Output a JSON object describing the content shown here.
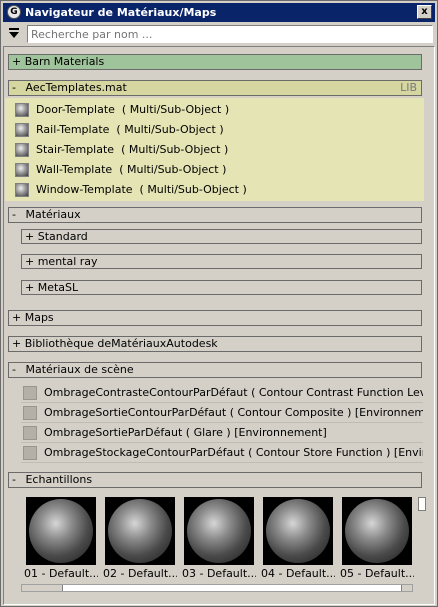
{
  "window": {
    "title": "Navigateur de Matériaux/Maps",
    "close_label": "x",
    "icon_label": "G"
  },
  "search": {
    "placeholder": "Recherche par nom ...",
    "value": ""
  },
  "groups": {
    "barn": {
      "toggle": "+",
      "label": "Barn Materials"
    },
    "aec": {
      "toggle": "-",
      "label": "AecTemplates.mat",
      "tag": "LIB",
      "items": [
        {
          "name": "Door-Template",
          "type": "( Multi/Sub-Object )"
        },
        {
          "name": "Rail-Template",
          "type": "( Multi/Sub-Object )"
        },
        {
          "name": "Stair-Template",
          "type": "( Multi/Sub-Object )"
        },
        {
          "name": "Wall-Template",
          "type": "( Multi/Sub-Object )"
        },
        {
          "name": "Window-Template",
          "type": "( Multi/Sub-Object )"
        }
      ]
    },
    "materiaux": {
      "toggle": "-",
      "label": "Matériaux",
      "subgroups": [
        {
          "toggle": "+",
          "label": "Standard"
        },
        {
          "toggle": "+",
          "label": "mental ray"
        },
        {
          "toggle": "+",
          "label": "MetaSL"
        }
      ]
    },
    "maps": {
      "toggle": "+",
      "label": "Maps"
    },
    "autodesk": {
      "toggle": "+",
      "label": "Bibliothèque deMatériauxAutodesk"
    },
    "scene": {
      "toggle": "-",
      "label": "Matériaux de scène",
      "items": [
        {
          "text": "OmbrageContrasteContourParDéfaut ( Contour Contrast Function Level..."
        },
        {
          "text": "OmbrageSortieContourParDéfaut ( Contour Composite ) [Environneme..."
        },
        {
          "text": "OmbrageSortieParDéfaut ( Glare ) [Environnement]"
        },
        {
          "text": "OmbrageStockageContourParDéfaut ( Contour Store Function ) [Enviro..."
        }
      ]
    },
    "echantillons": {
      "toggle": "-",
      "label": "Echantillons",
      "samples": [
        "01 - Default...",
        "02 - Default...",
        "03 - Default...",
        "04 - Default...",
        "05 - Default..."
      ]
    }
  },
  "colors": {
    "header_green": "#9fc39a",
    "library_bg": "#e4e4b4",
    "title_bar": "#0a246a"
  }
}
